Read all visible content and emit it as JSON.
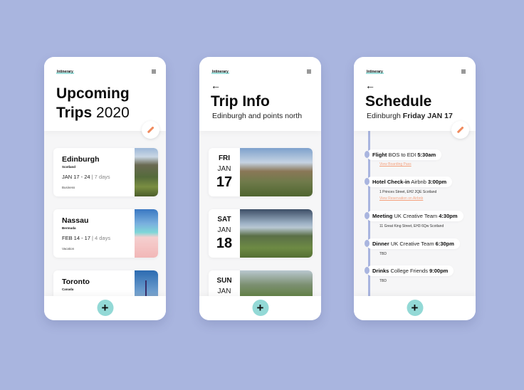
{
  "colors": {
    "background": "#a9b5df",
    "accent_teal": "#93d9d6",
    "accent_orange": "#f08a5d",
    "timeline": "#a9b5df"
  },
  "screens": [
    {
      "brand": "Intinerary",
      "title_bold_1": "Upcoming",
      "title_bold_2": "Trips",
      "title_light": "2020",
      "trips": [
        {
          "city": "Edinburgh",
          "country": "Scotland",
          "dates": "JAN 17 - 24",
          "duration": "7 days",
          "type": "Business"
        },
        {
          "city": "Nassau",
          "country": "Bermuda",
          "dates": "FEB 14 - 17",
          "duration": "4 days",
          "type": "Vacation"
        },
        {
          "city": "Toronto",
          "country": "Canada"
        }
      ],
      "icons": {
        "menu": "menu-icon",
        "edit": "pencil-icon",
        "add": "plus-icon"
      }
    },
    {
      "brand": "Intinerary",
      "back": "←",
      "title": "Trip Info",
      "subtitle": "Edinburgh and points north",
      "days": [
        {
          "dow": "FRI",
          "month": "JAN",
          "day": "17"
        },
        {
          "dow": "SAT",
          "month": "JAN",
          "day": "18"
        },
        {
          "dow": "SUN",
          "month": "JAN"
        }
      ]
    },
    {
      "brand": "Intinerary",
      "back": "←",
      "title": "Schedule",
      "subtitle_light": "Edinburgh",
      "subtitle_bold": "Friday JAN 17",
      "events": [
        {
          "type": "Flight",
          "desc": "BOS to EDI",
          "time": "5:30am",
          "link": "View Boarding Pass"
        },
        {
          "type": "Hotel Check-in",
          "desc": "Airbnb",
          "time": "3:00pm",
          "detail": "1 Princes Street, EH2 2QE Scotland",
          "link": "View Reservation on Airbnb"
        },
        {
          "type": "Meeting",
          "desc": "UK Creative Team",
          "time": "4:30pm",
          "detail": "11 Great King Street, EH3 6Qw Scotland"
        },
        {
          "type": "Dinner",
          "desc": "UK Creative Team",
          "time": "6:30pm",
          "detail": "TBD"
        },
        {
          "type": "Drinks",
          "desc": "College Friends",
          "time": "9:00pm",
          "detail": "TBD"
        }
      ]
    }
  ],
  "add_label": "+"
}
